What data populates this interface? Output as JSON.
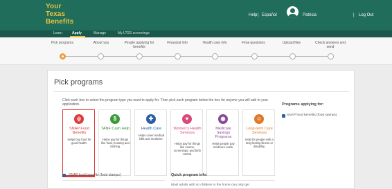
{
  "header": {
    "logo_line1": "Your",
    "logo_line2": "Texas",
    "logo_line3": "Benefits",
    "help": "Help",
    "separator": "|",
    "language": "Español",
    "user_name": "Patricia",
    "logout": "Log Out"
  },
  "subnav": {
    "items": [
      "Learn",
      "Apply",
      "Manage",
      "My LTSS screenings"
    ],
    "active": "Apply"
  },
  "progress": {
    "steps": [
      "Pick programs",
      "About you",
      "People applying for benefits",
      "Financial info",
      "Health care info",
      "Final questions",
      "Upload files",
      "Check answers and send"
    ],
    "current_index": 0
  },
  "main": {
    "title": "Pick programs",
    "instructions": "Click each box to select the program type you want to apply for. Then pick each program below the box for anyone you will add to your application.",
    "cards": [
      {
        "icon": "fork-knife-icon",
        "title": "SNAP Food Benefits",
        "desc": "Helps buy food for good health.",
        "color": "#e03a3a",
        "selected": true
      },
      {
        "icon": "dollar-icon",
        "title": "TANF Cash Help",
        "desc": "Helps pay for things like food, housing and clothing.",
        "color": "#3a9a3a",
        "selected": false
      },
      {
        "icon": "medical-cross-icon",
        "title": "Health Care",
        "desc": "Helps cover medical bills and medicine.",
        "color": "#2b5fa6",
        "selected": false
      },
      {
        "icon": "heart-icon",
        "title": "Women's Health Services",
        "desc": "Helps pay for things like exams, screenings, and birth control.",
        "color": "#d94a7b",
        "selected": false
      },
      {
        "icon": "medicare-icon",
        "title": "Medicare Savings Programs",
        "desc": "Helps people pay medicare costs.",
        "color": "#8a4a9a",
        "selected": false
      },
      {
        "icon": "hands-icon",
        "title": "Long-term Care Services",
        "desc": "Help for people with a long-lasting illness or disability.",
        "color": "#e07a2a",
        "selected": false
      }
    ],
    "sidebar_title": "Programs applying for:",
    "sidebar_item": "SNAP food benefits (food stamps)",
    "bottom_check_label": "SNAP food benefits (food stamps)",
    "quick_info_title": "Quick program info:",
    "quick_info_text": "Most adults with no children in the home can only get"
  },
  "colors": {
    "header_bg": "#1f6d5a",
    "logo": "#e8c33a",
    "active_step": "#f09a3e",
    "selected_card": "#e03a3a"
  }
}
